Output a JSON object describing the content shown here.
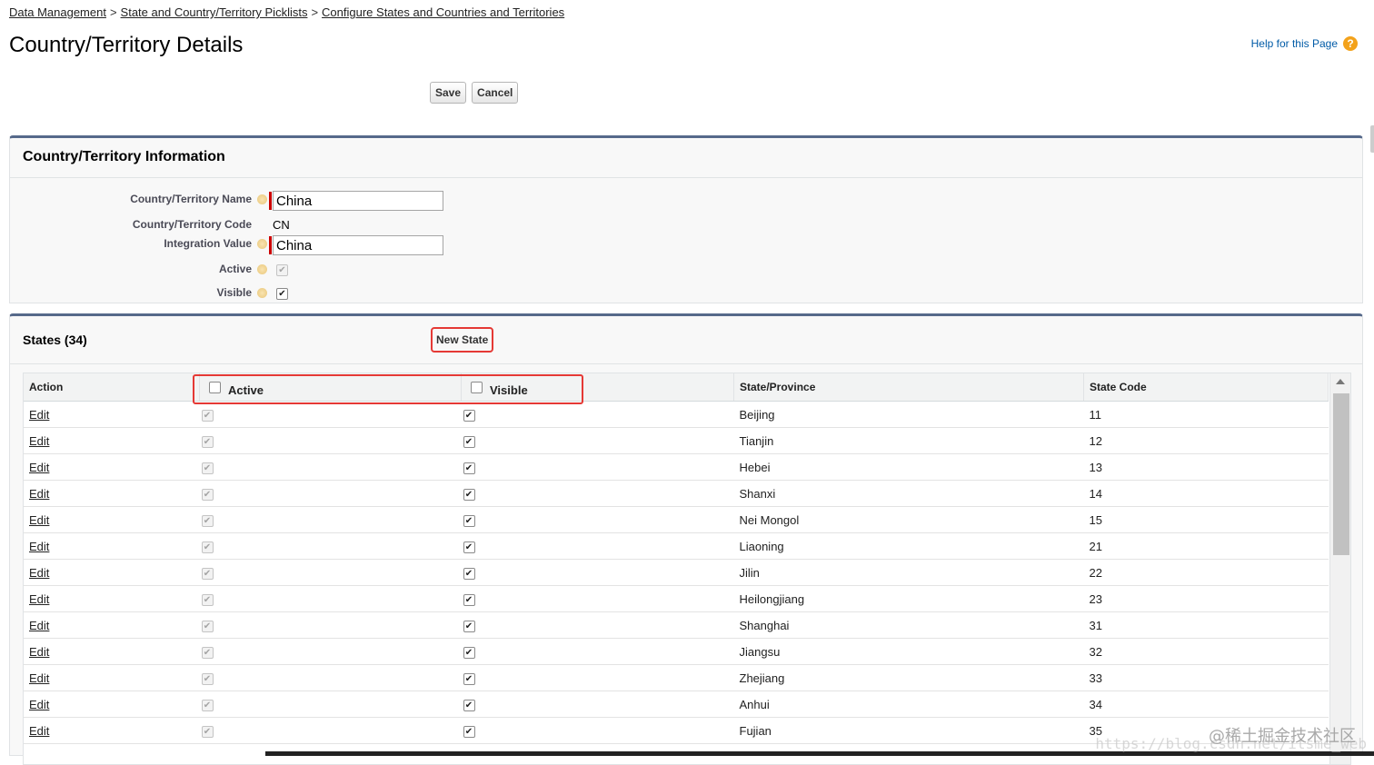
{
  "breadcrumb": {
    "items": [
      "Data Management",
      "State and Country/Territory Picklists",
      "Configure States and Countries and Territories"
    ],
    "separator": ">"
  },
  "page_title": "Country/Territory Details",
  "help": {
    "label": "Help for this Page",
    "icon": "question-icon",
    "icon_glyph": "?",
    "icon_color": "#f3a21b"
  },
  "buttons": {
    "save": "Save",
    "cancel": "Cancel",
    "new_state": "New State"
  },
  "info_section": {
    "title": "Country/Territory Information",
    "fields": {
      "name_label": "Country/Territory Name",
      "name_value": "China",
      "code_label": "Country/Territory Code",
      "code_value": "CN",
      "integration_label": "Integration Value",
      "integration_value": "China",
      "active_label": "Active",
      "active_checked": true,
      "visible_label": "Visible",
      "visible_checked": true
    }
  },
  "states_section": {
    "title": "States (34)",
    "columns": {
      "action": "Action",
      "active": "Active",
      "visible": "Visible",
      "state": "State/Province",
      "code": "State Code"
    },
    "edit_label": "Edit",
    "rows": [
      {
        "state": "Beijing",
        "code": "11"
      },
      {
        "state": "Tianjin",
        "code": "12"
      },
      {
        "state": "Hebei",
        "code": "13"
      },
      {
        "state": "Shanxi",
        "code": "14"
      },
      {
        "state": "Nei Mongol",
        "code": "15"
      },
      {
        "state": "Liaoning",
        "code": "21"
      },
      {
        "state": "Jilin",
        "code": "22"
      },
      {
        "state": "Heilongjiang",
        "code": "23"
      },
      {
        "state": "Shanghai",
        "code": "31"
      },
      {
        "state": "Jiangsu",
        "code": "32"
      },
      {
        "state": "Zhejiang",
        "code": "33"
      },
      {
        "state": "Anhui",
        "code": "34"
      },
      {
        "state": "Fujian",
        "code": "35"
      }
    ]
  },
  "colors": {
    "highlight": "#e53935",
    "panel_border": "#56698a",
    "required": "#c00",
    "link": "#015ba7"
  },
  "watermark": {
    "text": "@稀土掘金技术社区",
    "url": "https://blog.csdn.net/itsme_web"
  }
}
